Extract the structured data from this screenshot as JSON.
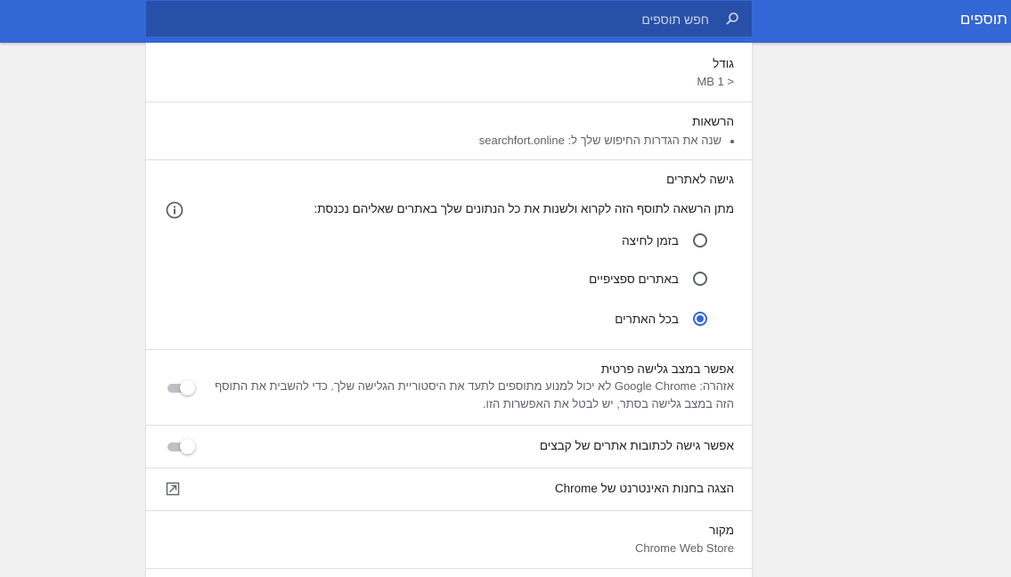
{
  "header": {
    "title": "תוספים",
    "search_placeholder": "חפש תוספים"
  },
  "size": {
    "label": "גודל",
    "value": "< 1 MB"
  },
  "permissions": {
    "label": "הרשאות",
    "items": [
      "שנה את הגדרות החיפוש שלך ל: searchfort.online"
    ]
  },
  "site_access": {
    "label": "גישה לאתרים",
    "description": "מתן הרשאה לתוסף הזה לקרוא ולשנות את כל הנתונים שלך באתרים שאליהם נכנסת:",
    "options": [
      {
        "label": "בזמן לחיצה",
        "selected": false
      },
      {
        "label": "באתרים ספציפיים",
        "selected": false
      },
      {
        "label": "בכל האתרים",
        "selected": true
      }
    ]
  },
  "incognito": {
    "label": "אפשר במצב גלישה פרטית",
    "warning": "אזהרה: Google Chrome לא יכול למנוע מתוספים לתעד את היסטוריית הגלישה שלך. כדי להשבית את התוסף הזה במצב גלישה בסתר, יש לבטל את האפשרות הזו.",
    "enabled": false
  },
  "file_urls": {
    "label": "אפשר גישה לכתובות אתרים של קבצים",
    "enabled": false
  },
  "webstore": {
    "label": "הצגה בחנות האינטרנט של Chrome"
  },
  "source": {
    "label": "מקור",
    "value": "Chrome Web Store"
  },
  "colors": {
    "accent": "#3367d6",
    "search_bg": "#2850a8"
  },
  "icons": {
    "search": "search-icon",
    "info": "info-icon",
    "external": "open-in-new-icon"
  }
}
